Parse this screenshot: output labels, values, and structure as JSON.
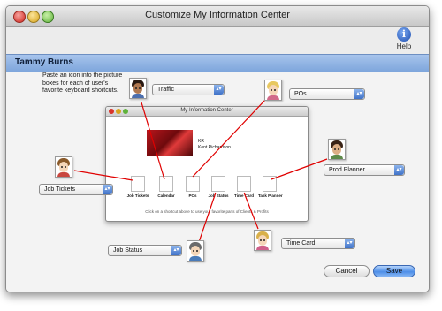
{
  "window": {
    "title": "Customize My Information Center"
  },
  "help": {
    "label": "Help",
    "glyph": "i"
  },
  "user": {
    "name": "Tammy Burns"
  },
  "instructions": "Paste an icon into the picture boxes for each of user's favorite keyboard shortcuts.",
  "dropdowns": {
    "traffic": "Traffic",
    "pos": "POs",
    "prod_planner": "Prod Planner",
    "job_tickets": "Job Tickets",
    "job_status": "Job Status",
    "time_card": "Time Card"
  },
  "inner_window": {
    "title": "My Information Center",
    "user_initials": "KR",
    "user_name": "Kent Richardson",
    "footer": "Click on a shortcut above to use your favorite parts of Clients & Profits",
    "shortcuts": [
      "Job Tickets",
      "Calendar",
      "POs",
      "Job Status",
      "Time Card",
      "Task Planner"
    ]
  },
  "buttons": {
    "cancel": "Cancel",
    "save": "Save"
  },
  "colors": {
    "accent": "#3f72c8",
    "link_line": "#e00000",
    "name_band": "#8fb2e2"
  }
}
